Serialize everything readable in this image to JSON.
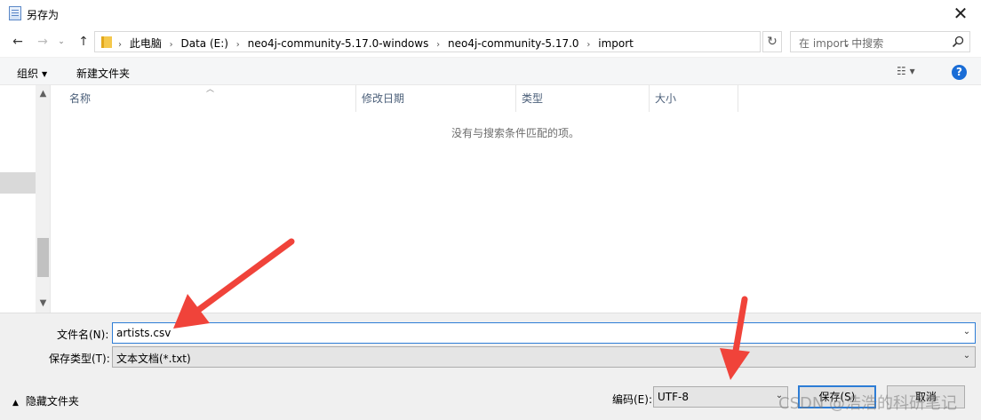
{
  "window": {
    "title": "另存为"
  },
  "nav": {
    "breadcrumbs": [
      "此电脑",
      "Data (E:)",
      "neo4j-community-5.17.0-windows",
      "neo4j-community-5.17.0",
      "import"
    ],
    "search_placeholder": "在 import 中搜索"
  },
  "toolbar": {
    "organize": "组织",
    "new_folder": "新建文件夹"
  },
  "file_list": {
    "columns": [
      "名称",
      "修改日期",
      "类型",
      "大小"
    ],
    "empty_message": "没有与搜索条件匹配的项。"
  },
  "form": {
    "filename_label": "文件名(N):",
    "filename_value": "artists.csv",
    "filetype_label": "保存类型(T):",
    "filetype_value": "文本文档(*.txt)",
    "encoding_label": "编码(E):",
    "encoding_value": "UTF-8"
  },
  "footer": {
    "hide_folders": "隐藏文件夹",
    "save_button": "保存(S)",
    "cancel_button": "取消"
  },
  "watermark": "CSDN @浩浩的科研笔记",
  "colors": {
    "accent": "#2d7dd6",
    "annotation_arrow": "#f0433a"
  },
  "icons": [
    "document-icon",
    "close-icon",
    "back-icon",
    "forward-icon",
    "chevron-down-icon",
    "up-icon",
    "folder-icon",
    "refresh-icon",
    "search-icon",
    "view-icon",
    "help-icon"
  ]
}
